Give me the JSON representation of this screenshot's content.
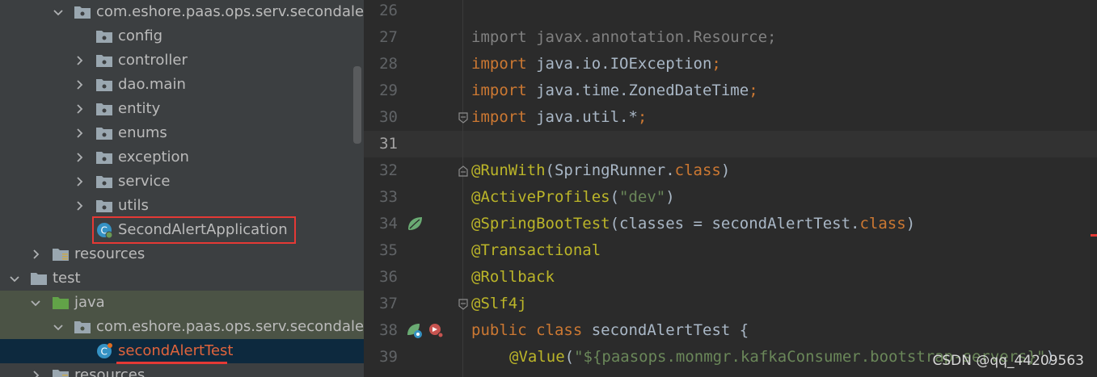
{
  "project_tree": {
    "rows": [
      {
        "label": "com.eshore.paas.ops.serv.secondaler",
        "expanded": true,
        "icon": "package-icon"
      },
      {
        "label": "config",
        "icon": "package-icon"
      },
      {
        "label": "controller",
        "expanded": false,
        "icon": "package-icon"
      },
      {
        "label": "dao.main",
        "expanded": false,
        "icon": "package-icon"
      },
      {
        "label": "entity",
        "expanded": false,
        "icon": "package-icon"
      },
      {
        "label": "enums",
        "expanded": false,
        "icon": "package-icon"
      },
      {
        "label": "exception",
        "expanded": false,
        "icon": "package-icon"
      },
      {
        "label": "service",
        "expanded": false,
        "icon": "package-icon"
      },
      {
        "label": "utils",
        "expanded": false,
        "icon": "package-icon"
      },
      {
        "label": "SecondAlertApplication",
        "icon": "spring-boot-class-icon"
      },
      {
        "label": "resources",
        "expanded": false,
        "icon": "resources-folder-icon"
      },
      {
        "label": "test",
        "expanded": true,
        "icon": "folder-icon"
      },
      {
        "label": "java",
        "expanded": true,
        "icon": "test-source-folder-icon"
      },
      {
        "label": "com.eshore.paas.ops.serv.secondaler",
        "expanded": true,
        "icon": "package-icon"
      },
      {
        "label": "secondAlertTest",
        "icon": "java-class-icon",
        "selected": true
      },
      {
        "label": "resources",
        "expanded": false,
        "icon": "resources-folder-icon"
      }
    ]
  },
  "editor": {
    "line_numbers": [
      "26",
      "27",
      "28",
      "29",
      "30",
      "31",
      "32",
      "33",
      "34",
      "35",
      "36",
      "37",
      "38",
      "39"
    ],
    "lines": {
      "l27": {
        "kw": "import",
        "rest": " javax.annotation.Resource;"
      },
      "l28": {
        "kw": "import",
        "rest": " java.io.IOException",
        "semi": ";"
      },
      "l29": {
        "kw": "import",
        "rest": " java.time.ZonedDateTime",
        "semi": ";"
      },
      "l30": {
        "kw": "import",
        "rest": " java.util.*",
        "semi": ";"
      },
      "l32": {
        "ann": "@RunWith",
        "p1": "(SpringRunner.",
        "kw": "class",
        "p2": ")"
      },
      "l33": {
        "ann": "@ActiveProfiles",
        "p1": "(",
        "str": "\"dev\"",
        "p2": ")"
      },
      "l34": {
        "ann": "@SpringBootTest",
        "p1": "(classes = ",
        "ref": "secondAlertTest",
        "dot": ".",
        "kw": "class",
        "p2": ")"
      },
      "l35": {
        "ann": "@Transactional"
      },
      "l36": {
        "ann": "@Rollback"
      },
      "l37": {
        "ann": "@Slf4j"
      },
      "l38": {
        "kw1": "public",
        "kw2": "class",
        "name": " secondAlertTest {"
      },
      "l39": {
        "ann": "@Value",
        "p1": "(",
        "str": "\"${paasops.monmgr.kafkaConsumer.bootstrap-servers}\"",
        "p2": ")"
      }
    }
  },
  "watermark": "CSDN @qq_44209563",
  "colors": {
    "keyword": "#cc7832",
    "annotation": "#bbb529",
    "string": "#6a8759",
    "text": "#a9b7c6",
    "highlight": "#e53935"
  }
}
